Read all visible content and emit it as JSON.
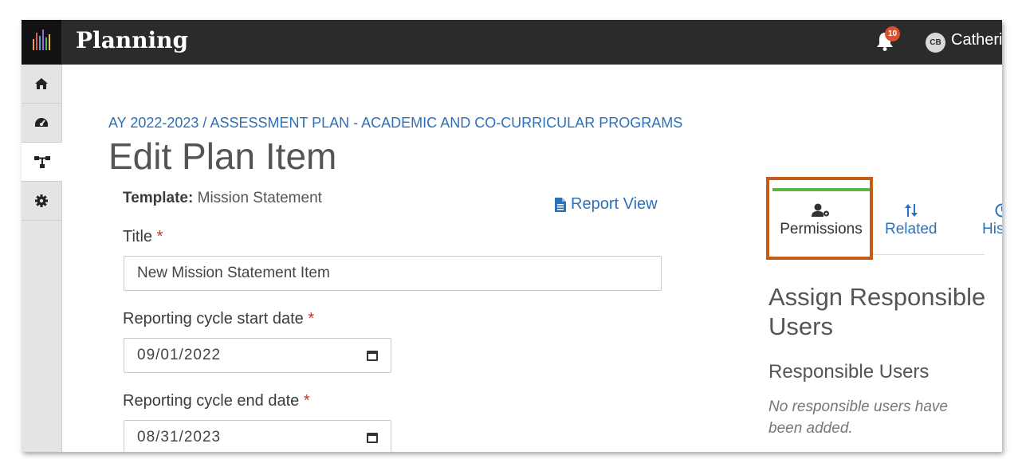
{
  "app": {
    "title": "Planning",
    "notification_count": "10",
    "user_initials": "CB",
    "user_name": "Catherine"
  },
  "sidebar": {
    "items": [
      {
        "icon": "home-icon"
      },
      {
        "icon": "dashboard-icon"
      },
      {
        "icon": "network-icon",
        "active": true
      },
      {
        "icon": "gear-icon"
      }
    ]
  },
  "breadcrumb": "AY 2022-2023 / ASSESSMENT PLAN - ACADEMIC AND CO-CURRICULAR PROGRAMS",
  "page_title": "Edit Plan Item",
  "template": {
    "label": "Template:",
    "value": "Mission Statement"
  },
  "report_view_label": "Report View",
  "form": {
    "title_label": "Title",
    "title_value": "New Mission Statement Item",
    "start_label": "Reporting cycle start date",
    "start_value": "09/01/2022",
    "end_label": "Reporting cycle end date",
    "end_value": "08/31/2023",
    "required_mark": "*"
  },
  "tabs": {
    "permissions": "Permissions",
    "related": "Related",
    "history": "Histor"
  },
  "permissions_panel": {
    "heading": "Assign Responsible Users",
    "subheading": "Responsible Users",
    "empty_text": "No responsible users have been added."
  },
  "colors": {
    "topbar": "#2b2b2b",
    "link": "#2d71b8",
    "highlight": "#c65b19",
    "active_tab": "#5cb346",
    "required": "#d0312d"
  }
}
